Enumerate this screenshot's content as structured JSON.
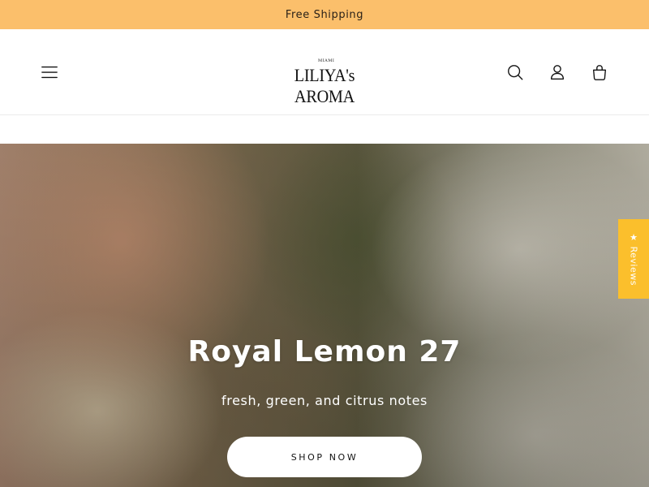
{
  "announcement": {
    "text": "Free Shipping"
  },
  "header": {
    "logo_small": "MIAMI",
    "logo_main": "LILIYA's AROMA",
    "icons": [
      "menu-icon",
      "search-icon",
      "account-icon",
      "cart-icon"
    ]
  },
  "hero": {
    "title": "Royal Lemon 27",
    "subtitle": "fresh, green, and citrus notes",
    "button_label": "SHOP NOW"
  },
  "reviews_tab": {
    "label": "★ Reviews"
  },
  "colors": {
    "announcement_bg": "#fbbf6b",
    "reviews_tab_bg": "#fbbf2c",
    "text": "#121212"
  }
}
